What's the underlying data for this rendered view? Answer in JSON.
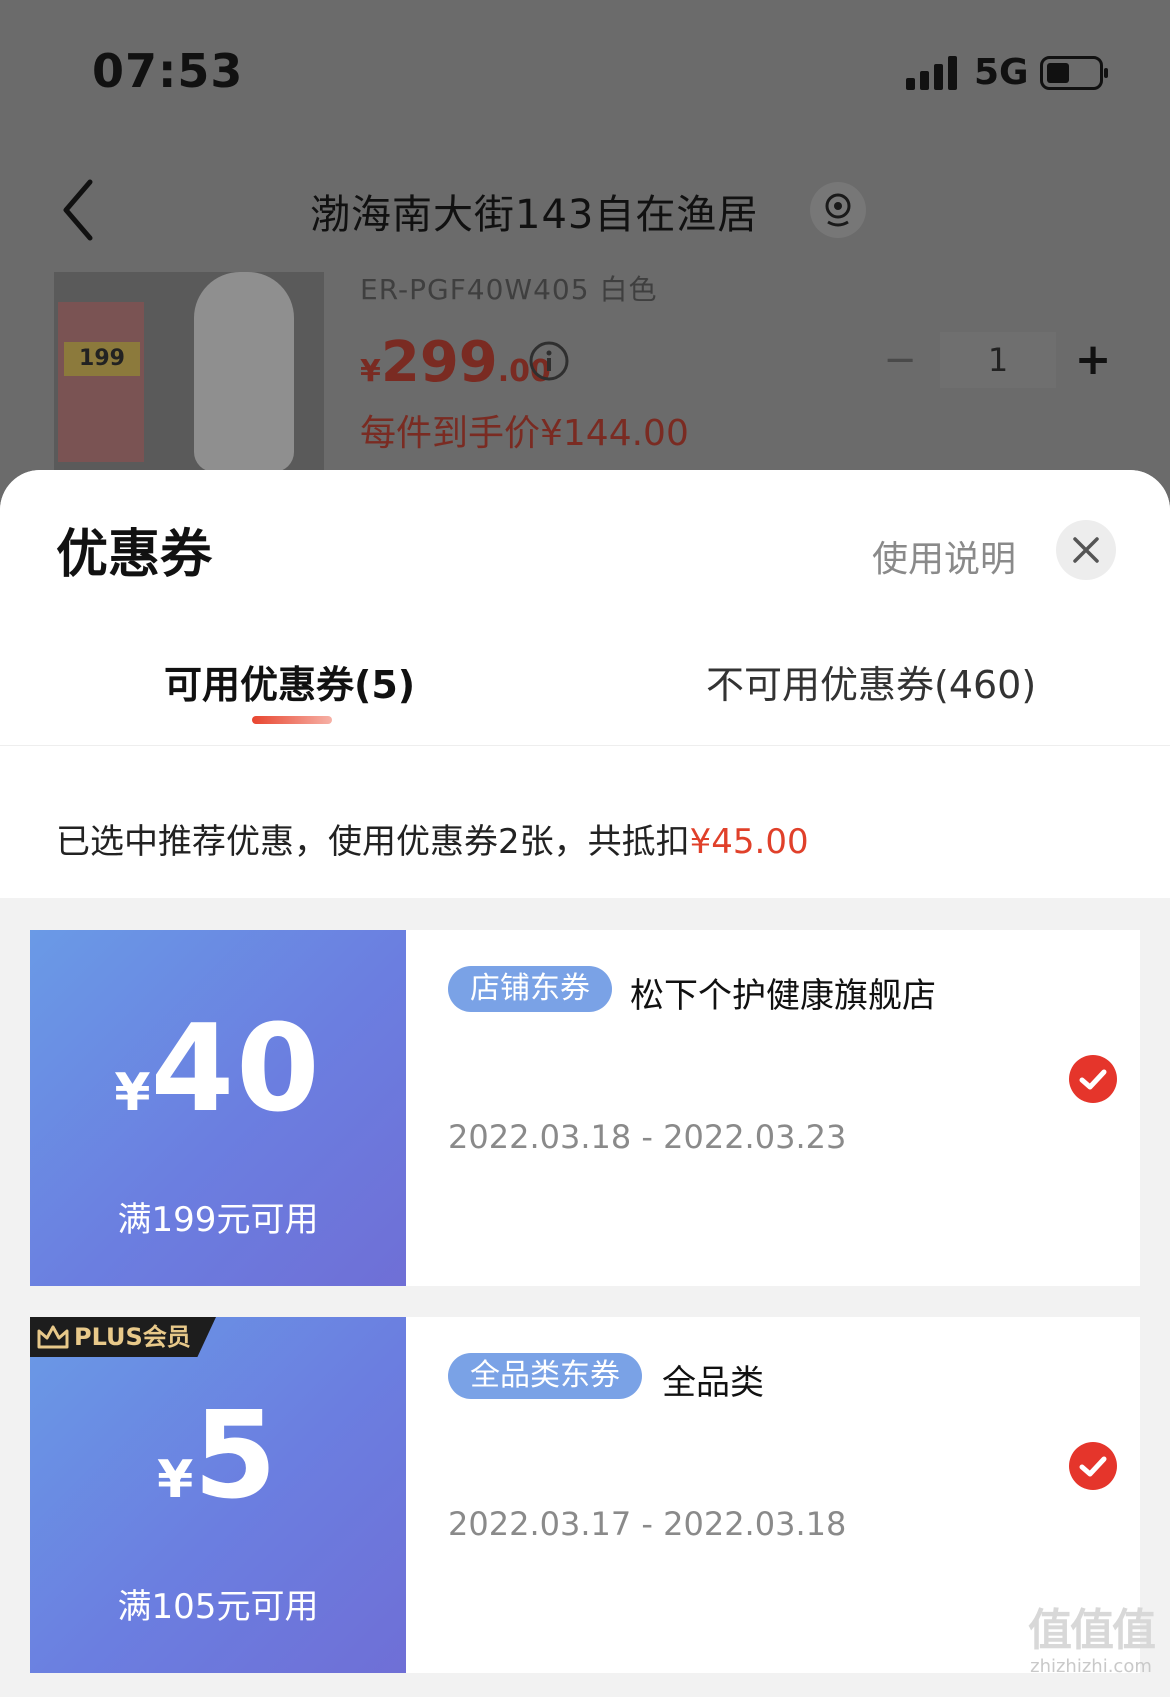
{
  "status_bar": {
    "time": "07:53",
    "network": "5G"
  },
  "nav": {
    "address": "渤海南大街143自在渔居"
  },
  "product": {
    "image_price": "199",
    "sku": "ER-PGF40W405 白色",
    "price_symbol": "¥",
    "price_integer": "299",
    "price_decimal": ".00",
    "final_price": "每件到手价¥144.00",
    "quantity": "1",
    "minus": "−",
    "plus": "+"
  },
  "sheet": {
    "title": "优惠券",
    "usage_link": "使用说明",
    "tabs": [
      {
        "label": "可用优惠券(5)",
        "active": true
      },
      {
        "label": "不可用优惠券(460)",
        "active": false
      }
    ],
    "summary_prefix": "已选中推荐优惠，使用优惠券2张，共抵扣",
    "summary_amount": "¥45.00"
  },
  "coupons": [
    {
      "yen": "¥",
      "value": "40",
      "threshold": "满199元可用",
      "tag": "店铺东券",
      "shop": "松下个护健康旗舰店",
      "dates": "2022.03.18 - 2022.03.23",
      "selected": true
    },
    {
      "badge": "PLUS会员",
      "yen": "¥",
      "value": "5",
      "threshold": "满105元可用",
      "tag": "全品类东券",
      "shop": "全品类",
      "dates": "2022.03.17 - 2022.03.18",
      "selected": true
    }
  ],
  "watermark": {
    "glyph": "值值值",
    "text": "zhizhizhi.com"
  },
  "colors": {
    "accent_red": "#e0402a",
    "coupon_blue": "#6b7ee0",
    "tag_blue": "#7aa2e6",
    "dim_overlay": "#6b6b6b"
  },
  "icons": [
    "back-icon",
    "location-icon",
    "info-icon",
    "close-icon",
    "check-icon",
    "crown-icon",
    "signal-icon",
    "battery-icon"
  ]
}
